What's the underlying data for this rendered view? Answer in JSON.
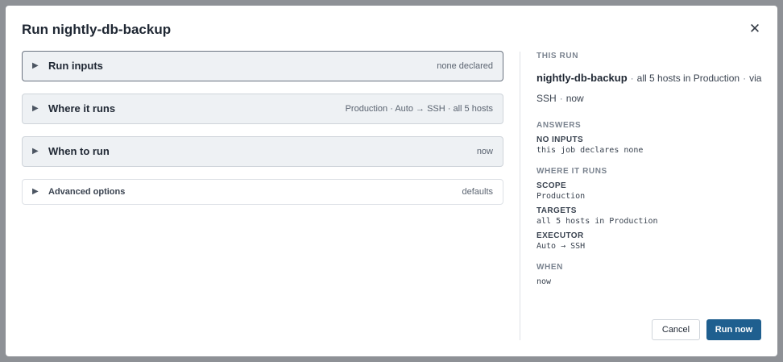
{
  "dialog": {
    "title": "Run nightly-db-backup",
    "close_label": "✕"
  },
  "sections": [
    {
      "label": "Run inputs",
      "summary": "none declared"
    },
    {
      "label": "Where it runs",
      "summary": "Production · Auto → SSH · all 5 hosts"
    },
    {
      "label": "When to run",
      "summary": "now"
    },
    {
      "label": "Advanced options",
      "summary": "defaults"
    }
  ],
  "expand_glyph": "▶",
  "this_run": {
    "heading": "THIS RUN",
    "job": "nightly-db-backup",
    "targets": "all 5 hosts in Production",
    "transport": "via SSH",
    "when": "now",
    "separator": "·"
  },
  "answers": {
    "heading": "ANSWERS",
    "items": [
      {
        "key": "NO INPUTS",
        "value": "this job declares none"
      }
    ]
  },
  "where": {
    "heading": "WHERE IT RUNS",
    "items": [
      {
        "key": "SCOPE",
        "value": "Production"
      },
      {
        "key": "TARGETS",
        "value": "all 5 hosts in Production"
      },
      {
        "key": "EXECUTOR",
        "value": "Auto → SSH"
      }
    ]
  },
  "when": {
    "heading": "WHEN",
    "value": "now"
  },
  "buttons": {
    "cancel": "Cancel",
    "run": "Run now"
  }
}
